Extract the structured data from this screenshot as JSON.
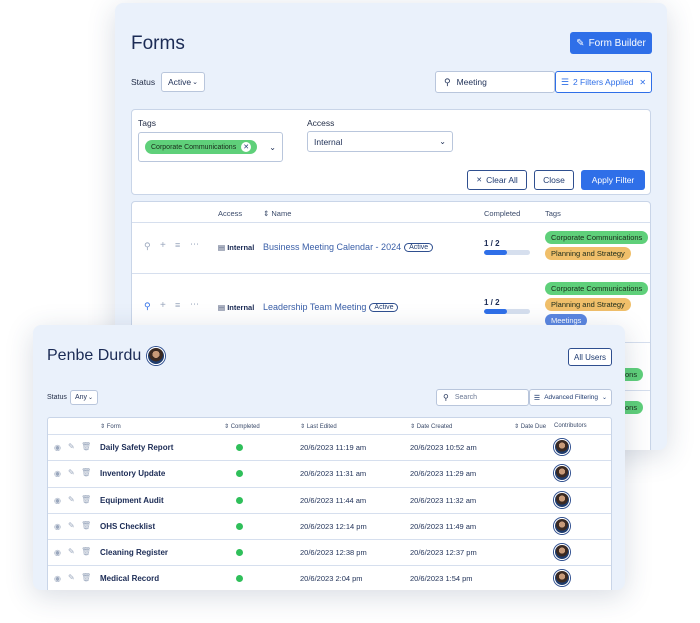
{
  "forms": {
    "title": "Forms",
    "form_builder_label": "Form Builder",
    "status_label": "Status",
    "status_value": "Active",
    "search_value": "Meeting",
    "filters_applied_label": "2 Filters Applied",
    "filter": {
      "tags_label": "Tags",
      "selected_tag": "Corporate Communications",
      "access_label": "Access",
      "access_value": "Internal",
      "clear_all_label": "Clear All",
      "close_label": "Close",
      "apply_label": "Apply Filter"
    },
    "table": {
      "headers": {
        "access": "Access",
        "name": "Name",
        "completed": "Completed",
        "tags": "Tags"
      },
      "rows": [
        {
          "access": "Internal",
          "name": "Business Meeting Calendar - 2024",
          "status": "Active",
          "completed": "1 / 2",
          "completed_fraction": 0.5,
          "tags": [
            "Corporate Communications",
            "Planning and Strategy"
          ]
        },
        {
          "access": "Internal",
          "name": "Leadership Team Meeting",
          "status": "Active",
          "completed": "1 / 2",
          "completed_fraction": 0.5,
          "tags": [
            "Corporate Communications",
            "Planning and Strategy",
            "Meetings"
          ]
        }
      ],
      "partial_tags": [
        "ons",
        "ons"
      ]
    }
  },
  "user": {
    "name": "Penbe Durdu",
    "all_users_label": "All Users",
    "status_label": "Status",
    "status_value": "Any",
    "search_placeholder": "Search",
    "advanced_filtering_label": "Advanced Filtering",
    "headers": {
      "form": "Form",
      "completed": "Completed",
      "last_edited": "Last Edited",
      "date_created": "Date Created",
      "date_due": "Date Due",
      "contributors": "Contributors"
    },
    "rows": [
      {
        "form": "Daily Safety Report",
        "last_edited": "20/6/2023 11:19 am",
        "date_created": "20/6/2023 10:52 am"
      },
      {
        "form": "Inventory Update",
        "last_edited": "20/6/2023 11:31 am",
        "date_created": "20/6/2023 11:29 am"
      },
      {
        "form": "Equipment Audit",
        "last_edited": "20/6/2023 11:44 am",
        "date_created": "20/6/2023 11:32 am"
      },
      {
        "form": "OHS Checklist",
        "last_edited": "20/6/2023 12:14 pm",
        "date_created": "20/6/2023 11:49 am"
      },
      {
        "form": "Cleaning Register",
        "last_edited": "20/6/2023 12:38 pm",
        "date_created": "20/6/2023 12:37 pm"
      },
      {
        "form": "Medical Record",
        "last_edited": "20/6/2023 2:04 pm",
        "date_created": "20/6/2023 1:54 pm"
      }
    ]
  },
  "colors": {
    "accent": "#2f6fe8",
    "panel_bg": "#eaf1fb",
    "tag_green": "#5fd07a",
    "tag_orange": "#f0bf6a",
    "tag_blue": "#5b86e0",
    "complete_dot": "#2fbf5a"
  }
}
